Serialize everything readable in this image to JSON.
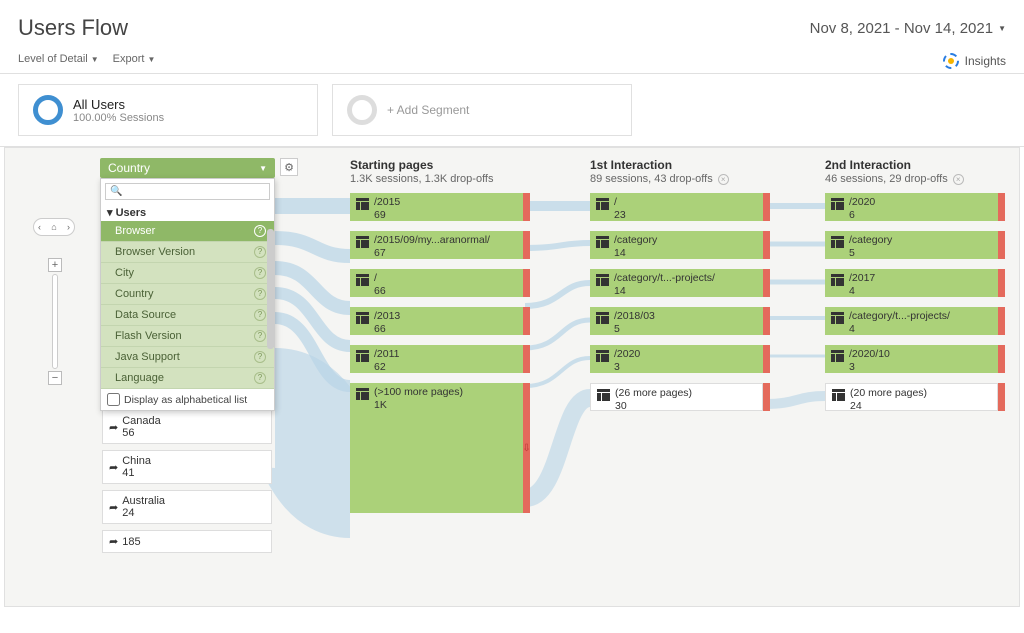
{
  "header": {
    "title": "Users Flow",
    "date_range": "Nov 8, 2021 - Nov 14, 2021"
  },
  "toolbar": {
    "level_detail": "Level of Detail",
    "export": "Export",
    "insights": "Insights"
  },
  "segments": {
    "all_users": {
      "title": "All Users",
      "sub": "100.00% Sessions"
    },
    "add": "+ Add Segment"
  },
  "dimension_dropdown": {
    "selected": "Country",
    "section": "Users",
    "search_placeholder": "🔍",
    "items": [
      "Browser",
      "Browser Version",
      "City",
      "Country",
      "Data Source",
      "Flash Version",
      "Java Support",
      "Language"
    ],
    "footer": "Display as alphabetical list"
  },
  "countries": [
    {
      "name": "Canada",
      "count": "56"
    },
    {
      "name": "China",
      "count": "41"
    },
    {
      "name": "Australia",
      "count": "24"
    },
    {
      "name": "",
      "count": "185"
    }
  ],
  "columns": {
    "starting": {
      "title": "Starting pages",
      "sub": "1.3K sessions, 1.3K drop-offs",
      "nodes": [
        {
          "path": "/2015",
          "count": "69"
        },
        {
          "path": "/2015/09/my...aranormal/",
          "count": "67"
        },
        {
          "path": "/",
          "count": "66"
        },
        {
          "path": "/2013",
          "count": "66"
        },
        {
          "path": "/2011",
          "count": "62"
        },
        {
          "path": "(>100 more pages)",
          "count": "1K"
        }
      ]
    },
    "first": {
      "title": "1st Interaction",
      "sub": "89 sessions, 43 drop-offs",
      "nodes": [
        {
          "path": "/",
          "count": "23"
        },
        {
          "path": "/category",
          "count": "14"
        },
        {
          "path": "/category/t...-projects/",
          "count": "14"
        },
        {
          "path": "/2018/03",
          "count": "5"
        },
        {
          "path": "/2020",
          "count": "3"
        },
        {
          "path": "(26 more pages)",
          "count": "30"
        }
      ]
    },
    "second": {
      "title": "2nd Interaction",
      "sub": "46 sessions, 29 drop-offs",
      "nodes": [
        {
          "path": "/2020",
          "count": "6"
        },
        {
          "path": "/category",
          "count": "5"
        },
        {
          "path": "/2017",
          "count": "4"
        },
        {
          "path": "/category/t...-projects/",
          "count": "4"
        },
        {
          "path": "/2020/10",
          "count": "3"
        },
        {
          "path": "(20 more pages)",
          "count": "24"
        }
      ]
    }
  }
}
